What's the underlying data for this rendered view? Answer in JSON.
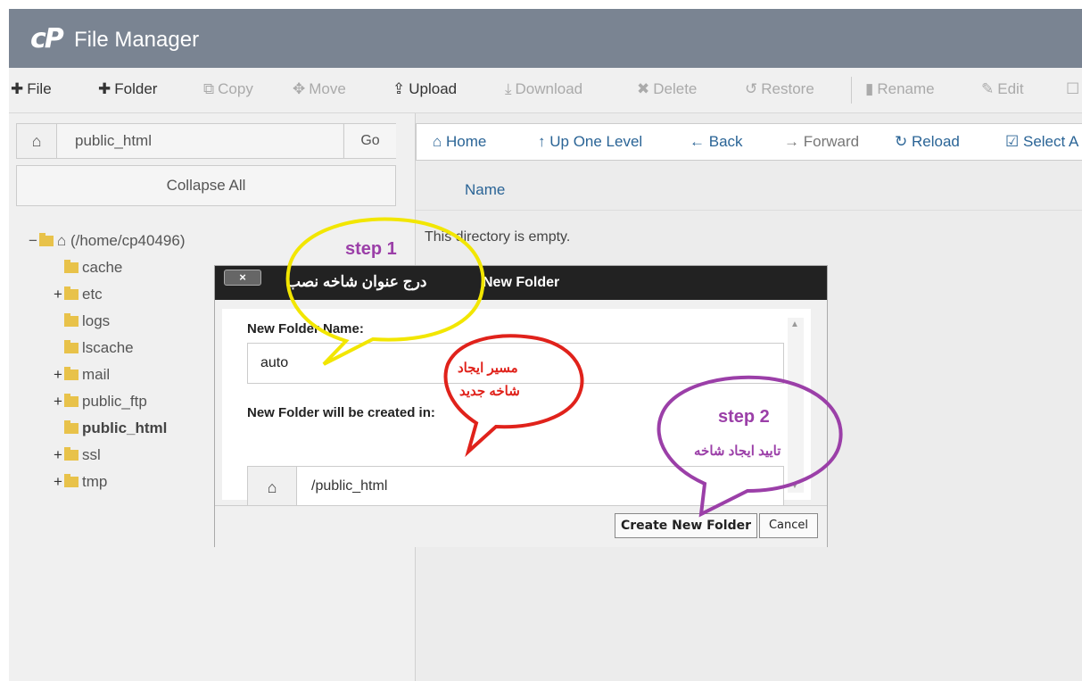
{
  "app": {
    "logo": "cP",
    "title": "File Manager"
  },
  "toolbar": {
    "file": "File",
    "folder": "Folder",
    "copy": "Copy",
    "move": "Move",
    "upload": "Upload",
    "download": "Download",
    "delete": "Delete",
    "restore": "Restore",
    "rename": "Rename",
    "edit": "Edit"
  },
  "left": {
    "path_value": "public_html",
    "go": "Go",
    "collapse": "Collapse All",
    "tree": {
      "root": "(/home/cp40496)",
      "items": [
        "cache",
        "etc",
        "logs",
        "lscache",
        "mail",
        "public_ftp",
        "public_html",
        "ssl",
        "tmp"
      ]
    }
  },
  "nav": {
    "home": "Home",
    "up": "Up One Level",
    "back": "Back",
    "forward": "Forward",
    "reload": "Reload",
    "select": "Select A"
  },
  "list": {
    "col_name": "Name",
    "empty": "This directory is empty."
  },
  "dialog": {
    "close": "×",
    "title": "New Folder",
    "title_overlay": "درج عنوان شاخه نصب",
    "name_label": "New Folder Name:",
    "name_value": "auto",
    "location_label": "New Folder will be created in:",
    "location_value": "/public_html",
    "create_btn": "Create New Folder",
    "cancel_btn": "Cancel"
  },
  "annotations": {
    "step1": "step 1",
    "step2": "step 2",
    "path_note_line1": "مسیر ایجاد",
    "path_note_line2": "شاخه جدید",
    "confirm_note": "تایید ایجاد شاخه",
    "colors": {
      "yellow": "#f2e600",
      "red": "#e0221b",
      "purple": "#9b3fa8"
    }
  }
}
